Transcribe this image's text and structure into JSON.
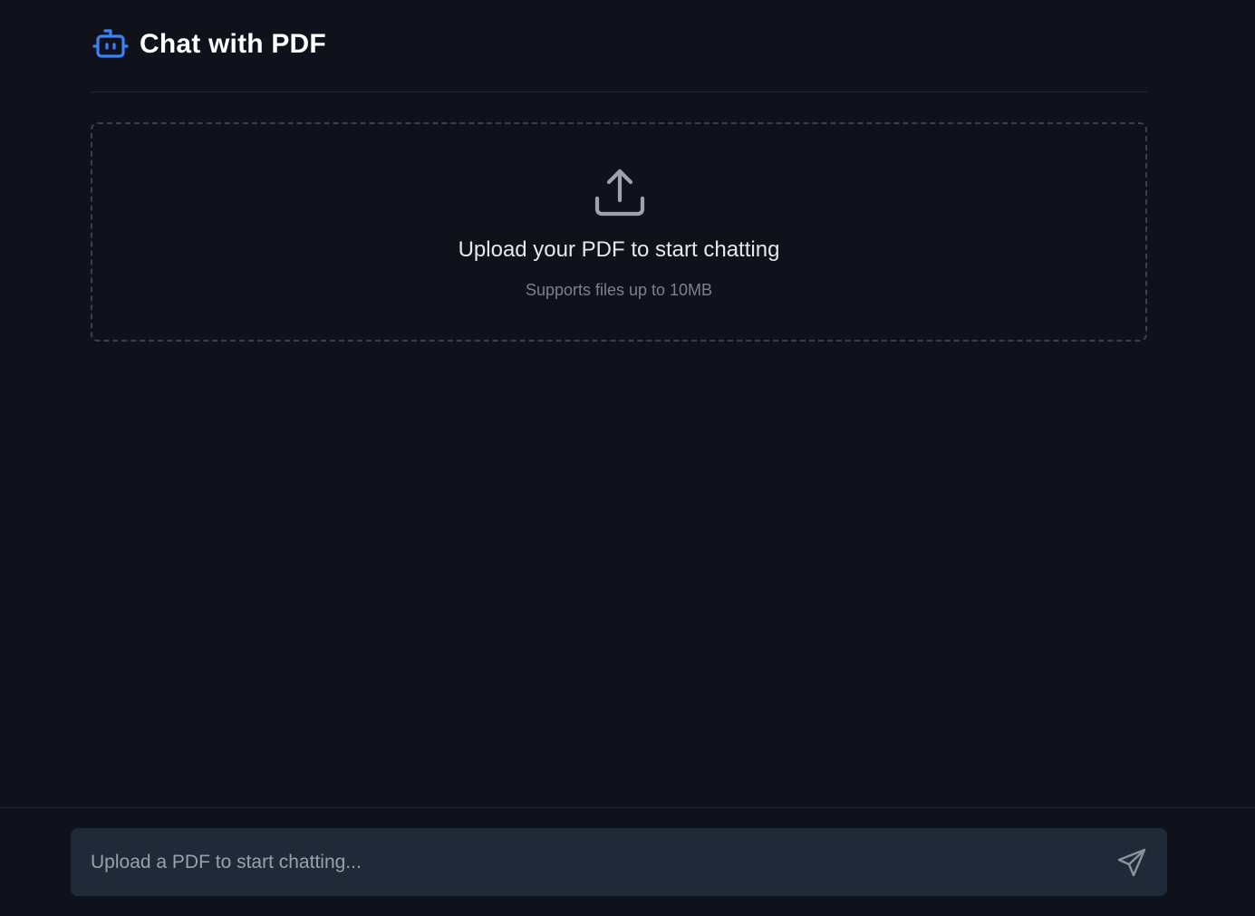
{
  "header": {
    "title": "Chat with PDF",
    "icon": "robot-icon",
    "icon_color": "#3b82f6"
  },
  "upload": {
    "icon": "upload-icon",
    "title": "Upload your PDF to start chatting",
    "subtitle": "Supports files up to 10MB"
  },
  "chat": {
    "placeholder": "Upload a PDF to start chatting...",
    "value": "",
    "send_icon": "send-icon"
  },
  "colors": {
    "background": "#0f121a",
    "input_background": "#1f2937",
    "accent": "#3b82f6"
  }
}
